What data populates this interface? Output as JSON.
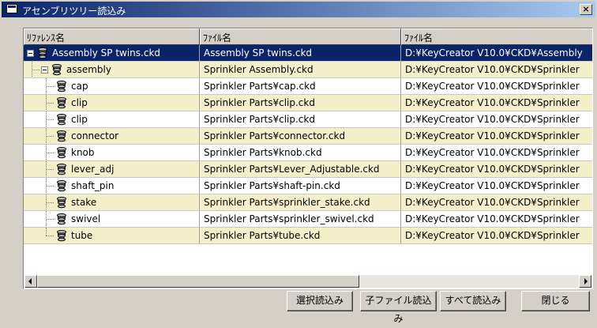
{
  "window": {
    "title": "アセンブリツリー読込み",
    "close_label": "×"
  },
  "columns": [
    "ﾘﾌｧﾚﾝｽ名",
    "ﾌｧｲﾙ名",
    "ﾌｧｲﾙ名"
  ],
  "rows": [
    {
      "name": "Assembly SP twins.ckd",
      "file": "Assembly SP twins.ckd",
      "path": "D:¥KeyCreator V10.0¥CKD¥Assembly",
      "level": 0,
      "selected": true
    },
    {
      "name": "assembly",
      "file": "Sprinkler Assembly.ckd",
      "path": "D:¥KeyCreator V10.0¥CKD¥Sprinkler",
      "level": 1
    },
    {
      "name": "cap",
      "file": "Sprinkler Parts¥cap.ckd",
      "path": "D:¥KeyCreator V10.0¥CKD¥Sprinkler",
      "level": 2
    },
    {
      "name": "clip",
      "file": "Sprinkler Parts¥clip.ckd",
      "path": "D:¥KeyCreator V10.0¥CKD¥Sprinkler",
      "level": 2
    },
    {
      "name": "clip",
      "file": "Sprinkler Parts¥clip.ckd",
      "path": "D:¥KeyCreator V10.0¥CKD¥Sprinkler",
      "level": 2
    },
    {
      "name": "connector",
      "file": "Sprinkler Parts¥connector.ckd",
      "path": "D:¥KeyCreator V10.0¥CKD¥Sprinkler",
      "level": 2
    },
    {
      "name": "knob",
      "file": "Sprinkler Parts¥knob.ckd",
      "path": "D:¥KeyCreator V10.0¥CKD¥Sprinkler",
      "level": 2
    },
    {
      "name": "lever_adj",
      "file": "Sprinkler Parts¥Lever_Adjustable.ckd",
      "path": "D:¥KeyCreator V10.0¥CKD¥Sprinkler",
      "level": 2
    },
    {
      "name": "shaft_pin",
      "file": "Sprinkler Parts¥shaft-pin.ckd",
      "path": "D:¥KeyCreator V10.0¥CKD¥Sprinkler",
      "level": 2
    },
    {
      "name": "stake",
      "file": "Sprinkler Parts¥sprinkler_stake.ckd",
      "path": "D:¥KeyCreator V10.0¥CKD¥Sprinkler",
      "level": 2
    },
    {
      "name": "swivel",
      "file": "Sprinkler Parts¥sprinkler_swivel.ckd",
      "path": "D:¥KeyCreator V10.0¥CKD¥Sprinkler",
      "level": 2
    },
    {
      "name": "tube",
      "file": "Sprinkler Parts¥tube.ckd",
      "path": "D:¥KeyCreator V10.0¥CKD¥Sprinkler",
      "level": 2
    }
  ],
  "buttons": {
    "load_selected": "選択読込み",
    "load_children": "子ファイル読込み",
    "load_all": "すべて読込み",
    "close": "閉じる"
  },
  "colors": {
    "titlebar": "#0a246a",
    "row_alt": "#f3efc9",
    "selection": "#0a246a"
  }
}
